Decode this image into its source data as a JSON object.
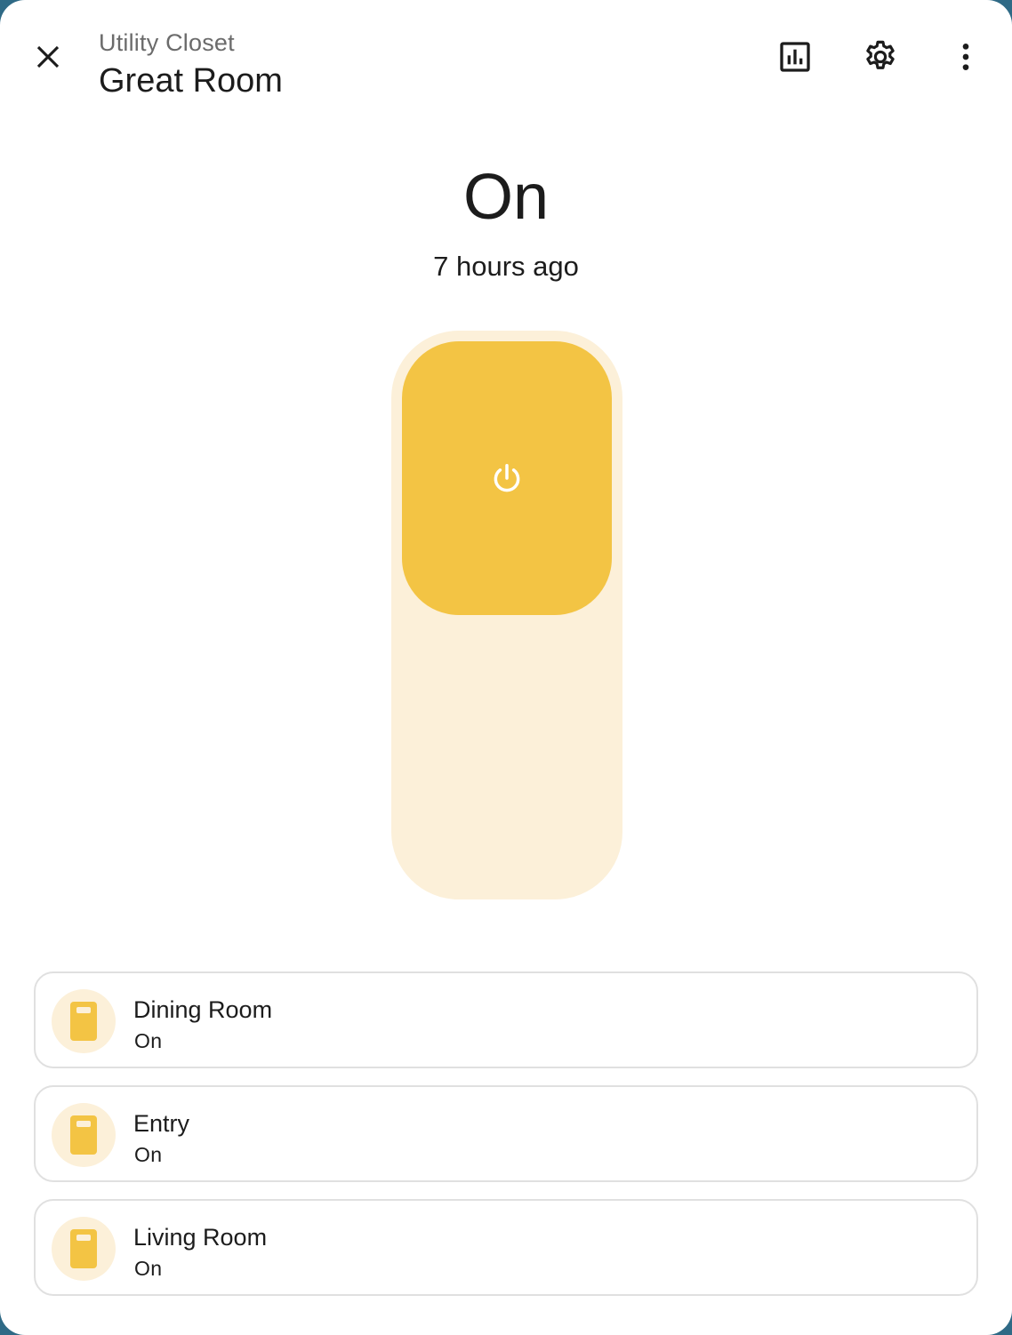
{
  "header": {
    "breadcrumb": "Utility Closet",
    "title": "Great Room",
    "icons": [
      "close-icon",
      "history-chart-icon",
      "settings-gear-icon",
      "more-vertical-icon"
    ]
  },
  "state": {
    "value": "On",
    "last_changed": "7 hours ago"
  },
  "toggle": {
    "is_on": true,
    "icon": "power-icon"
  },
  "colors": {
    "accent": "#f3c444",
    "accent_light": "#fcf0d9",
    "text": "#1c1c1c",
    "secondary_text": "#6b6b6b",
    "border": "#e0e0e0"
  },
  "entities": [
    {
      "name": "Dining Room",
      "state": "On",
      "icon": "light-switch-icon"
    },
    {
      "name": "Entry",
      "state": "On",
      "icon": "light-switch-icon"
    },
    {
      "name": "Living Room",
      "state": "On",
      "icon": "light-switch-icon"
    }
  ]
}
